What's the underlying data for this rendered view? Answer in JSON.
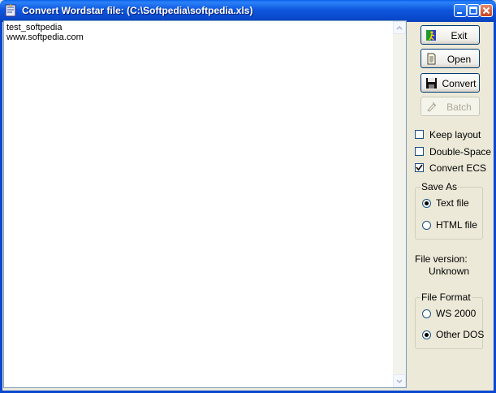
{
  "window": {
    "title": "Convert Wordstar file: (C:\\Softpedia\\softpedia.xls)",
    "icons": {
      "app": "app-icon",
      "minimize": "minimize-icon",
      "maximize": "maximize-icon",
      "close": "close-icon"
    }
  },
  "editor": {
    "text": "test_softpedia\nwww.softpedia.com"
  },
  "buttons": {
    "exit": {
      "label": "Exit",
      "icon": "exit-icon"
    },
    "open": {
      "label": "Open",
      "icon": "open-file-icon"
    },
    "convert": {
      "label": "Convert",
      "icon": "save-disk-icon"
    },
    "batch": {
      "label": "Batch",
      "icon": "batch-icon",
      "disabled": true
    }
  },
  "options": {
    "keep_layout": {
      "label": "Keep layout",
      "checked": false
    },
    "double_space": {
      "label": "Double-Space",
      "checked": false
    },
    "convert_ecs": {
      "label": "Convert ECS",
      "checked": true
    }
  },
  "save_as": {
    "title": "Save As",
    "text_file": {
      "label": "Text file",
      "selected": true
    },
    "html_file": {
      "label": "HTML file",
      "selected": false
    }
  },
  "file_version": {
    "label": "File version:",
    "value": "Unknown"
  },
  "file_format": {
    "title": "File Format",
    "ws2000": {
      "label": "WS 2000",
      "selected": false
    },
    "other_dos": {
      "label": "Other DOS",
      "selected": true
    }
  },
  "colors": {
    "titlebar": "#0A5FE8",
    "face": "#ECE9D8",
    "check": "#21A121"
  }
}
